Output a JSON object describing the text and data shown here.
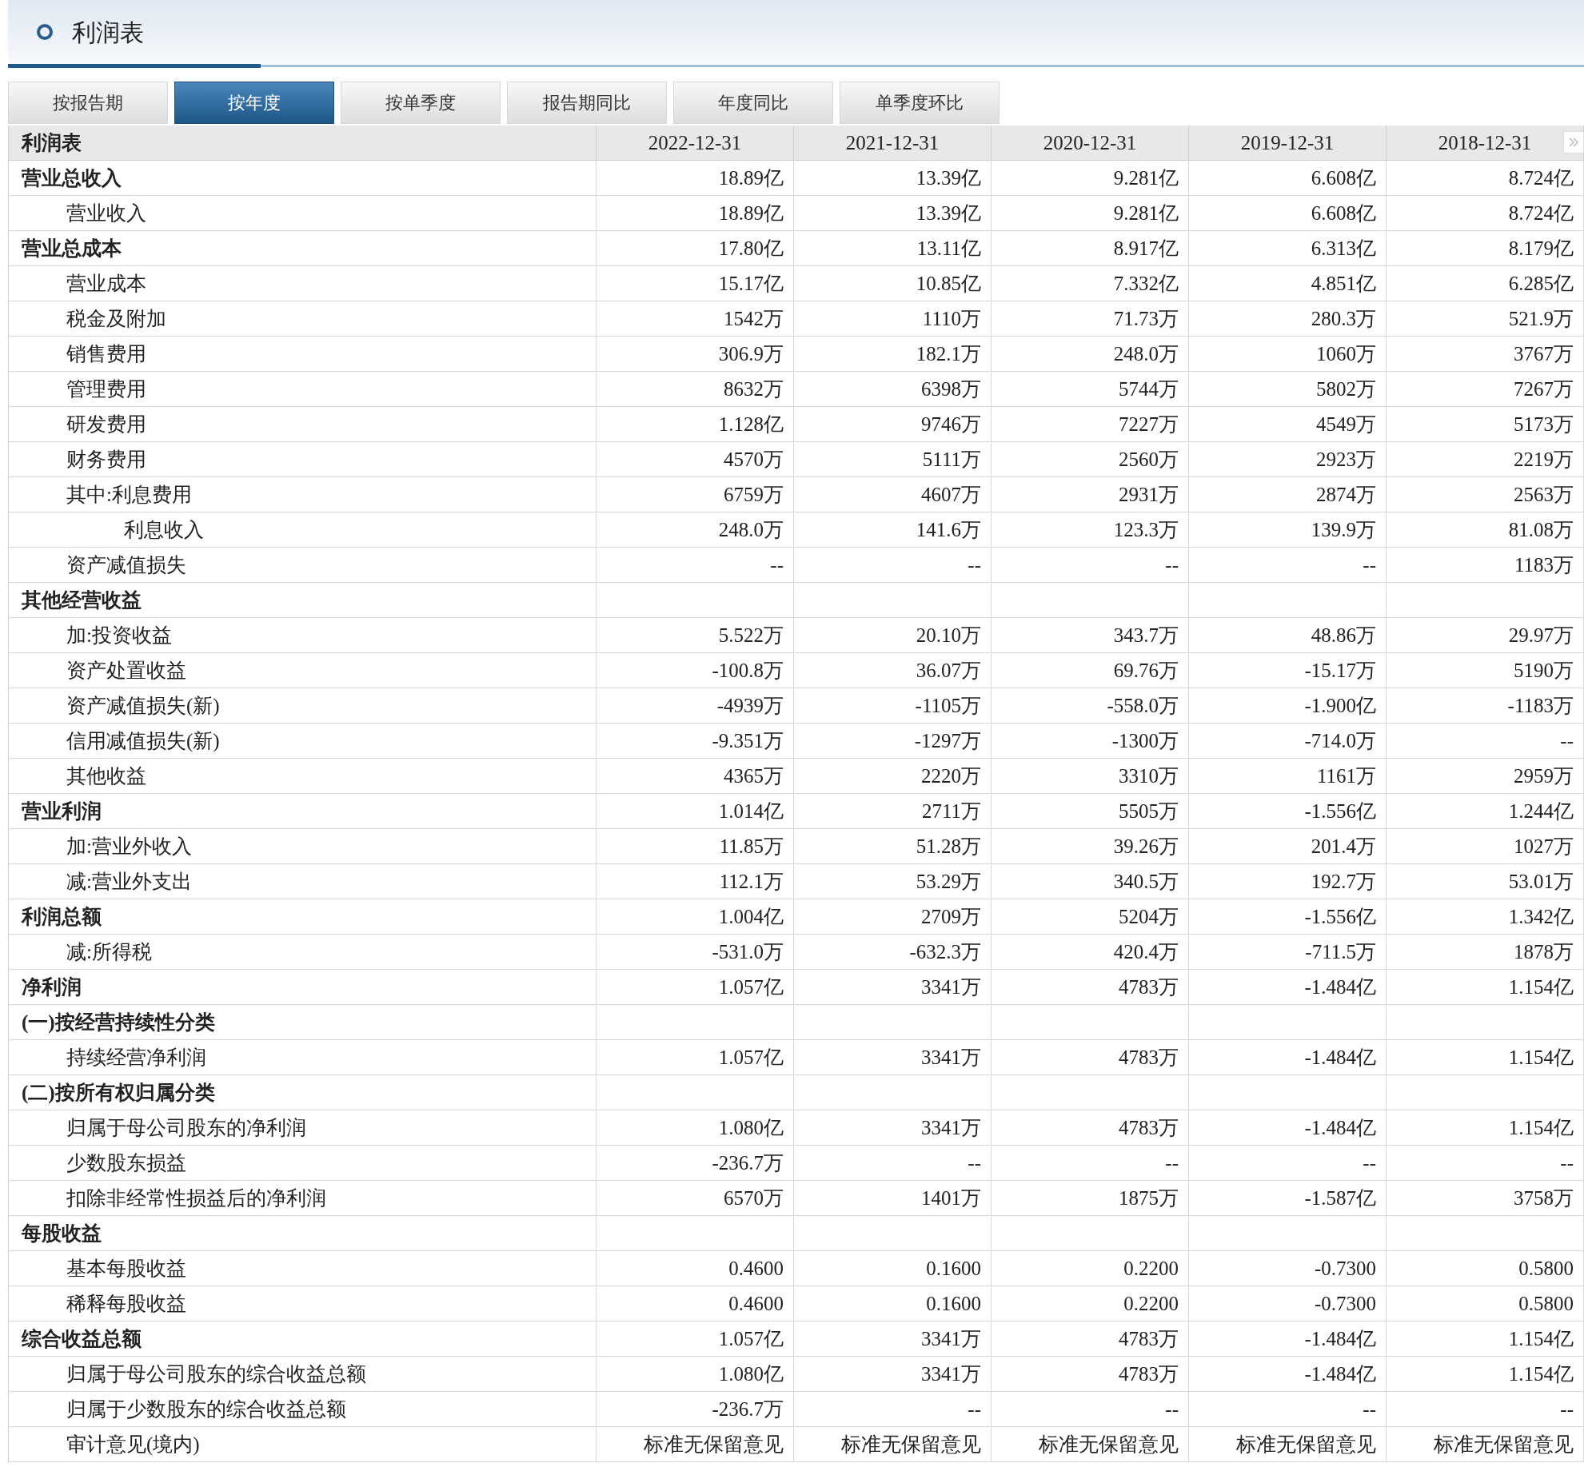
{
  "title": "利润表",
  "tabs": [
    {
      "label": "按报告期",
      "selected": false
    },
    {
      "label": "按年度",
      "selected": true
    },
    {
      "label": "按单季度",
      "selected": false
    },
    {
      "label": "报告期同比",
      "selected": false
    },
    {
      "label": "年度同比",
      "selected": false
    },
    {
      "label": "单季度环比",
      "selected": false
    }
  ],
  "table": {
    "columns": [
      "利润表",
      "2022-12-31",
      "2021-12-31",
      "2020-12-31",
      "2019-12-31",
      "2018-12-31"
    ],
    "rows": [
      {
        "kind": "section",
        "label": "营业总收入",
        "values": [
          "18.89亿",
          "13.39亿",
          "9.281亿",
          "6.608亿",
          "8.724亿"
        ]
      },
      {
        "kind": "item",
        "label": "营业收入",
        "values": [
          "18.89亿",
          "13.39亿",
          "9.281亿",
          "6.608亿",
          "8.724亿"
        ]
      },
      {
        "kind": "section",
        "label": "营业总成本",
        "values": [
          "17.80亿",
          "13.11亿",
          "8.917亿",
          "6.313亿",
          "8.179亿"
        ]
      },
      {
        "kind": "item",
        "label": "营业成本",
        "values": [
          "15.17亿",
          "10.85亿",
          "7.332亿",
          "4.851亿",
          "6.285亿"
        ]
      },
      {
        "kind": "item",
        "label": "税金及附加",
        "values": [
          "1542万",
          "1110万",
          "71.73万",
          "280.3万",
          "521.9万"
        ]
      },
      {
        "kind": "item",
        "label": "销售费用",
        "values": [
          "306.9万",
          "182.1万",
          "248.0万",
          "1060万",
          "3767万"
        ]
      },
      {
        "kind": "item",
        "label": "管理费用",
        "values": [
          "8632万",
          "6398万",
          "5744万",
          "5802万",
          "7267万"
        ]
      },
      {
        "kind": "item",
        "label": "研发费用",
        "values": [
          "1.128亿",
          "9746万",
          "7227万",
          "4549万",
          "5173万"
        ]
      },
      {
        "kind": "item",
        "label": "财务费用",
        "values": [
          "4570万",
          "5111万",
          "2560万",
          "2923万",
          "2219万"
        ]
      },
      {
        "kind": "item",
        "label": "其中:利息费用",
        "values": [
          "6759万",
          "4607万",
          "2931万",
          "2874万",
          "2563万"
        ]
      },
      {
        "kind": "subitem",
        "label": "利息收入",
        "values": [
          "248.0万",
          "141.6万",
          "123.3万",
          "139.9万",
          "81.08万"
        ]
      },
      {
        "kind": "item",
        "label": "资产减值损失",
        "values": [
          "--",
          "--",
          "--",
          "--",
          "1183万"
        ]
      },
      {
        "kind": "section",
        "label": "其他经营收益"
      },
      {
        "kind": "item",
        "label": "加:投资收益",
        "values": [
          "5.522万",
          "20.10万",
          "343.7万",
          "48.86万",
          "29.97万"
        ]
      },
      {
        "kind": "item",
        "label": "资产处置收益",
        "values": [
          "-100.8万",
          "36.07万",
          "69.76万",
          "-15.17万",
          "5190万"
        ]
      },
      {
        "kind": "item",
        "label": "资产减值损失(新)",
        "values": [
          "-4939万",
          "-1105万",
          "-558.0万",
          "-1.900亿",
          "-1183万"
        ]
      },
      {
        "kind": "item",
        "label": "信用减值损失(新)",
        "values": [
          "-9.351万",
          "-1297万",
          "-1300万",
          "-714.0万",
          "--"
        ]
      },
      {
        "kind": "item",
        "label": "其他收益",
        "values": [
          "4365万",
          "2220万",
          "3310万",
          "1161万",
          "2959万"
        ]
      },
      {
        "kind": "section",
        "label": "营业利润",
        "values": [
          "1.014亿",
          "2711万",
          "5505万",
          "-1.556亿",
          "1.244亿"
        ]
      },
      {
        "kind": "item",
        "label": "加:营业外收入",
        "values": [
          "11.85万",
          "51.28万",
          "39.26万",
          "201.4万",
          "1027万"
        ]
      },
      {
        "kind": "item",
        "label": "减:营业外支出",
        "values": [
          "112.1万",
          "53.29万",
          "340.5万",
          "192.7万",
          "53.01万"
        ]
      },
      {
        "kind": "section",
        "label": "利润总额",
        "values": [
          "1.004亿",
          "2709万",
          "5204万",
          "-1.556亿",
          "1.342亿"
        ]
      },
      {
        "kind": "item",
        "label": "减:所得税",
        "values": [
          "-531.0万",
          "-632.3万",
          "420.4万",
          "-711.5万",
          "1878万"
        ]
      },
      {
        "kind": "section",
        "label": "净利润",
        "values": [
          "1.057亿",
          "3341万",
          "4783万",
          "-1.484亿",
          "1.154亿"
        ]
      },
      {
        "kind": "section",
        "label": "(一)按经营持续性分类"
      },
      {
        "kind": "item",
        "label": "持续经营净利润",
        "values": [
          "1.057亿",
          "3341万",
          "4783万",
          "-1.484亿",
          "1.154亿"
        ]
      },
      {
        "kind": "section",
        "label": "(二)按所有权归属分类"
      },
      {
        "kind": "item",
        "label": "归属于母公司股东的净利润",
        "values": [
          "1.080亿",
          "3341万",
          "4783万",
          "-1.484亿",
          "1.154亿"
        ]
      },
      {
        "kind": "item",
        "label": "少数股东损益",
        "values": [
          "-236.7万",
          "--",
          "--",
          "--",
          "--"
        ]
      },
      {
        "kind": "item",
        "label": "扣除非经常性损益后的净利润",
        "values": [
          "6570万",
          "1401万",
          "1875万",
          "-1.587亿",
          "3758万"
        ]
      },
      {
        "kind": "section",
        "label": "每股收益"
      },
      {
        "kind": "item",
        "label": "基本每股收益",
        "values": [
          "0.4600",
          "0.1600",
          "0.2200",
          "-0.7300",
          "0.5800"
        ]
      },
      {
        "kind": "item",
        "label": "稀释每股收益",
        "values": [
          "0.4600",
          "0.1600",
          "0.2200",
          "-0.7300",
          "0.5800"
        ]
      },
      {
        "kind": "section",
        "label": "综合收益总额",
        "values": [
          "1.057亿",
          "3341万",
          "4783万",
          "-1.484亿",
          "1.154亿"
        ]
      },
      {
        "kind": "item",
        "label": "归属于母公司股东的综合收益总额",
        "values": [
          "1.080亿",
          "3341万",
          "4783万",
          "-1.484亿",
          "1.154亿"
        ]
      },
      {
        "kind": "item",
        "label": "归属于少数股东的综合收益总额",
        "values": [
          "-236.7万",
          "--",
          "--",
          "--",
          "--"
        ]
      },
      {
        "kind": "item",
        "label": "审计意见(境内)",
        "values": [
          "标准无保留意见",
          "标准无保留意见",
          "标准无保留意见",
          "标准无保留意见",
          "标准无保留意见"
        ]
      }
    ]
  }
}
